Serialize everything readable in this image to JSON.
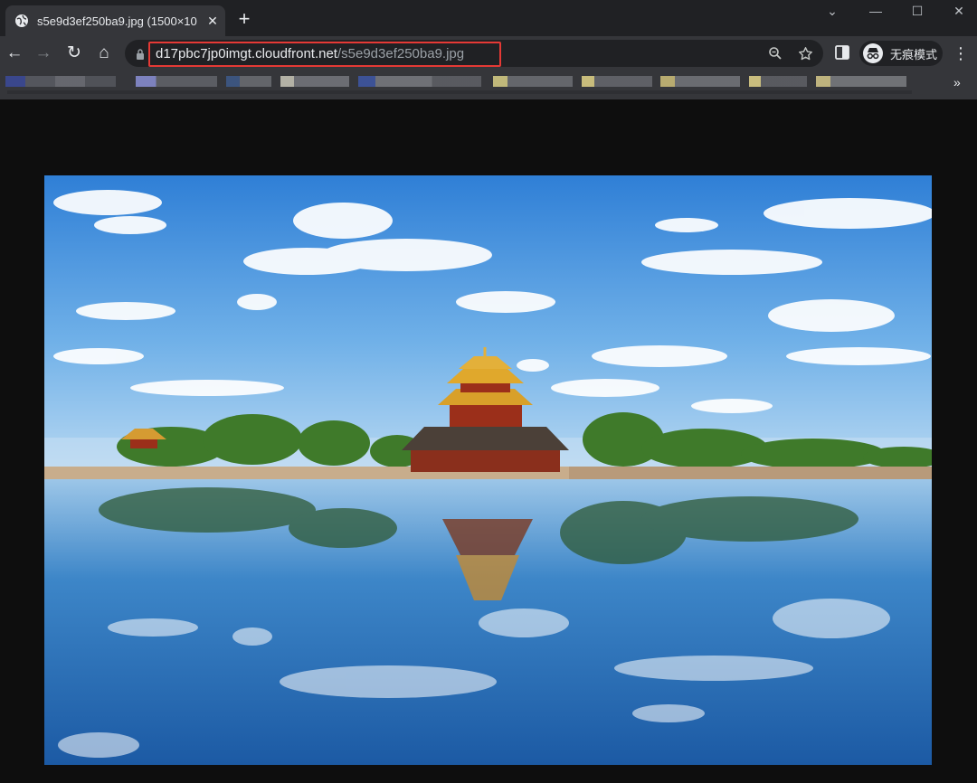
{
  "tab": {
    "title": "s5e9d3ef250ba9.jpg (1500×10",
    "favicon": "globe-icon"
  },
  "window": {
    "minimize": "—",
    "maximize": "☐",
    "close": "✕",
    "tabsearch": "⌄"
  },
  "nav": {
    "back": "←",
    "forward": "→",
    "reload": "↻",
    "home": "⌂",
    "newtab": "+"
  },
  "omnibox": {
    "host": "d17pbc7jp0imgt.cloudfront.net",
    "path": "/s5e9d3ef250ba9.jpg",
    "highlight_color": "#e53935"
  },
  "profile": {
    "label": "无痕模式",
    "icon": "incognito-icon"
  },
  "bookmarks": {
    "overflow": "»"
  },
  "colors": {
    "tabstrip": "#202124",
    "toolbar": "#35363a",
    "viewport": "#0e0e0e"
  }
}
